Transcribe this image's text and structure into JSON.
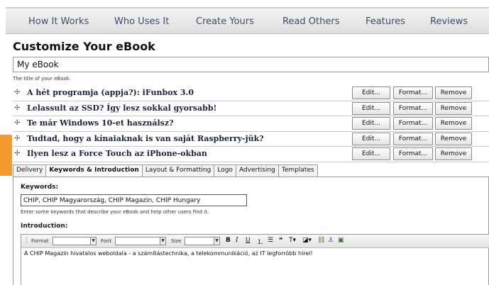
{
  "nav": [
    "How It Works",
    "Who Uses It",
    "Create Yours",
    "Read Others",
    "Features",
    "Reviews"
  ],
  "page_title": "Customize Your eBook",
  "title_input": {
    "value": "My eBook",
    "help": "The title of your eBook."
  },
  "chapters": [
    {
      "title": "A hét programja (appja?): iFunbox 3.0"
    },
    {
      "title": "Lelassult az SSD? Így lesz sokkal gyorsabb!"
    },
    {
      "title": "Te már Windows 10-et használsz?"
    },
    {
      "title": "Tudtad, hogy a kínaiaknak is van saját Raspberry-jük?"
    },
    {
      "title": "Ilyen lesz a Force Touch az iPhone-okban"
    }
  ],
  "chapter_buttons": {
    "edit": "Edit...",
    "format": "Format...",
    "remove": "Remove"
  },
  "tabs": [
    "Delivery",
    "Keywords & Introduction",
    "Layout & Formatting",
    "Logo",
    "Advertising",
    "Templates"
  ],
  "active_tab": "Keywords & Introduction",
  "keywords": {
    "label": "Keywords:",
    "value": "CHIP, CHIP Magyarország, CHIP Magazin, CHIP Hungary",
    "help": "Enter some keywords that describe your eBook and help other users find it."
  },
  "introduction": {
    "label": "Introduction:",
    "toolbar": {
      "format": "Format",
      "font": "Font",
      "size": "Size"
    },
    "content": "A CHIP Magazin hivatalos weboldala - a számítástechnika, a telekommunikáció, az IT legforróbb hírei!"
  },
  "colors": {
    "accent_marker": "#f29a2e",
    "nav_text": "#3c4b6e",
    "chapter_text": "#1a2240"
  }
}
